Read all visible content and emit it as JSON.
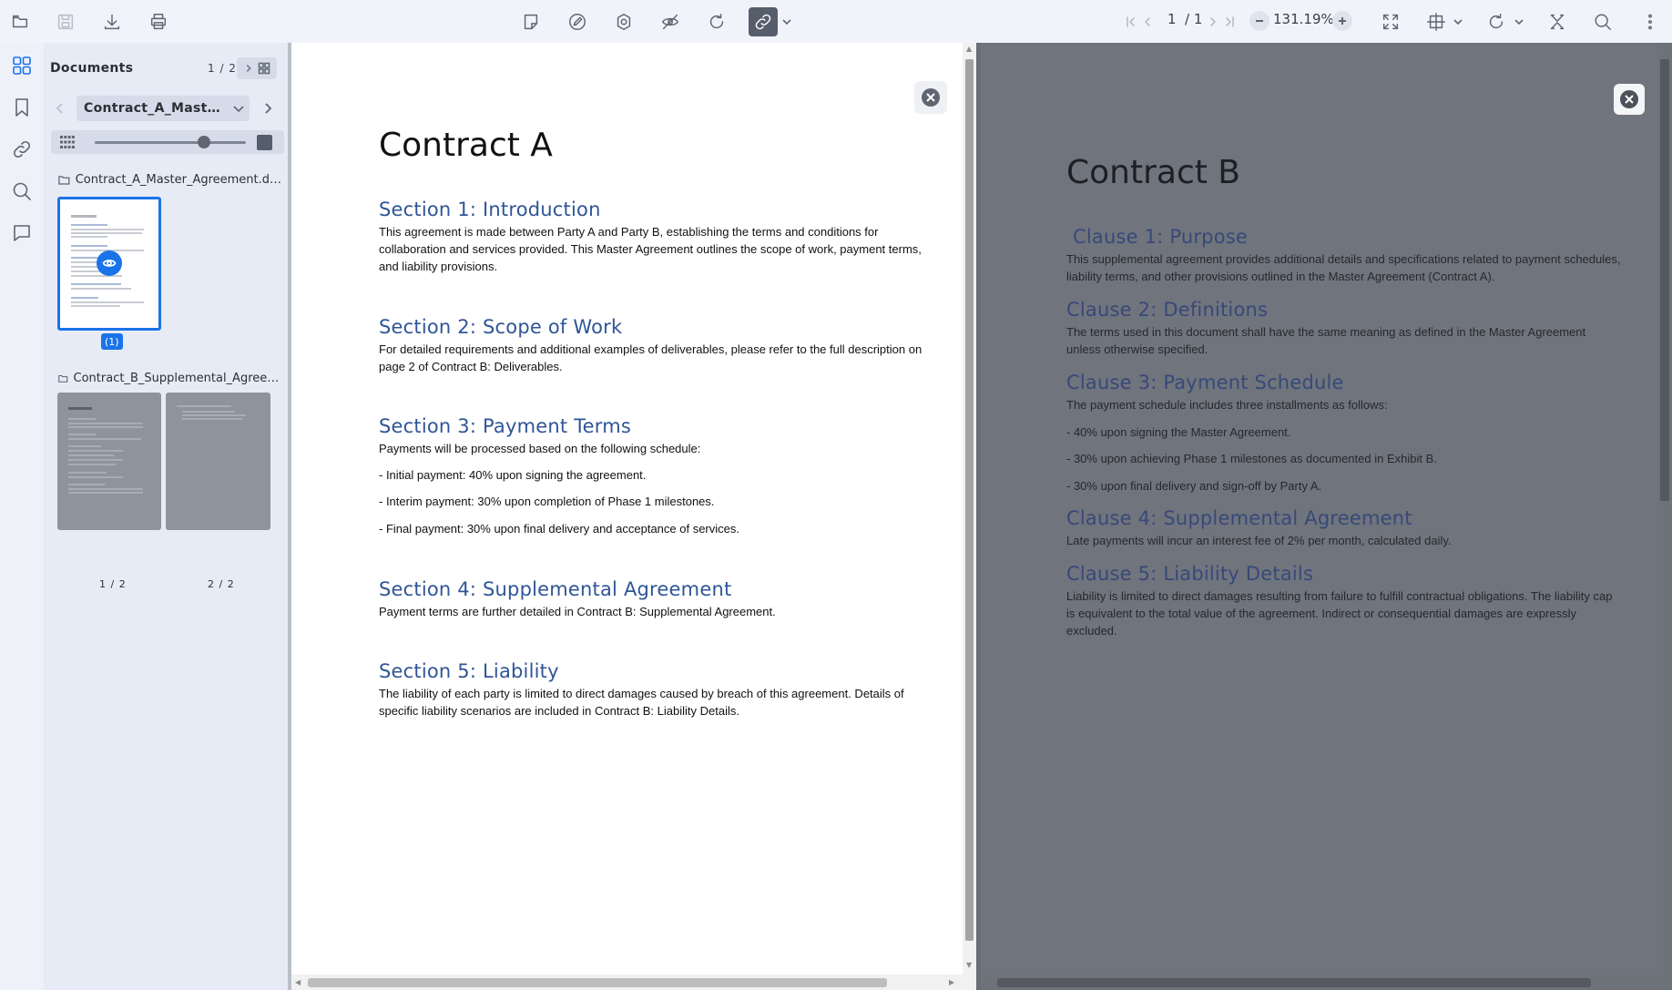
{
  "toolbar": {
    "page_current": "1",
    "page_total": "/ 1",
    "zoom": "131.19%"
  },
  "panel": {
    "title": "Documents",
    "count": "1 / 2",
    "selected_document": "Contract_A_Master_Agreement.docx",
    "size_slider_value": 0.72,
    "files": [
      {
        "name": "Contract_A_Master_Agreement.docx",
        "pages": [
          {
            "label": "(1)",
            "selected": true
          }
        ]
      },
      {
        "name": "Contract_B_Supplemental_Agreement.docx",
        "pages": [
          {
            "label": "1 / 2"
          },
          {
            "label": "2 / 2"
          }
        ]
      }
    ]
  },
  "docA": {
    "title": "Contract A",
    "sections": [
      {
        "heading": "Section 1: Introduction",
        "paragraphs": [
          "This agreement is made between Party A and Party B, establishing the terms and conditions for collaboration and services provided. This Master Agreement outlines the scope of work, payment terms, and liability provisions."
        ]
      },
      {
        "heading": "Section 2: Scope of Work",
        "paragraphs": [
          "For detailed requirements and additional examples of deliverables, please refer to the full description on page 2 of Contract B: Deliverables."
        ]
      },
      {
        "heading": "Section 3: Payment Terms",
        "paragraphs": [
          "Payments will be processed based on the following schedule:",
          "- Initial payment: 40% upon signing the agreement.",
          "- Interim payment: 30% upon completion of Phase 1 milestones.",
          "- Final payment: 30% upon final delivery and acceptance of services."
        ]
      },
      {
        "heading": "Section 4: Supplemental Agreement",
        "paragraphs": [
          "Payment terms are further detailed in Contract B: Supplemental Agreement."
        ]
      },
      {
        "heading": "Section 5: Liability",
        "paragraphs": [
          "The liability of each party is limited to direct damages caused by breach of this agreement. Details of specific liability scenarios are included in Contract B: Liability Details."
        ]
      }
    ]
  },
  "docB": {
    "title": "Contract B",
    "sections": [
      {
        "heading": "Clause 1: Purpose",
        "paragraphs": [
          "This supplemental agreement provides additional details and specifications related to payment schedules, liability terms, and other provisions outlined in the Master Agreement (Contract A)."
        ]
      },
      {
        "heading": "Clause 2: Definitions",
        "paragraphs": [
          "The terms used in this document shall have the same meaning as defined in the Master Agreement unless otherwise specified."
        ]
      },
      {
        "heading": "Clause 3: Payment Schedule",
        "paragraphs": [
          "The payment schedule includes three installments as follows:",
          "- 40% upon signing the Master Agreement.",
          "- 30% upon achieving Phase 1 milestones as documented in Exhibit B.",
          "- 30% upon final delivery and sign-off by Party A."
        ]
      },
      {
        "heading": "Clause 4: Supplemental Agreement",
        "paragraphs": [
          "Late payments will incur an interest fee of 2% per month, calculated daily."
        ]
      },
      {
        "heading": "Clause 5: Liability Details",
        "paragraphs": [
          "Liability is limited to direct damages resulting from failure to fulfill contractual obligations. The liability cap is equivalent to the total value of the agreement. Indirect or consequential damages are expressly excluded."
        ]
      }
    ]
  },
  "colors": {
    "accent": "#1a73e8",
    "heading": "#2f5597",
    "dim_overlay": "#70747c"
  },
  "icons": [
    "folder-open-icon",
    "save-icon",
    "download-icon",
    "print-icon",
    "note-icon",
    "draw-icon",
    "settings-icon",
    "hide-icon",
    "rotate-icon",
    "link-icon",
    "first-page-icon",
    "prev-page-icon",
    "next-page-icon",
    "last-page-icon",
    "zoom-out-icon",
    "zoom-in-icon",
    "fullscreen-icon",
    "fit-icon",
    "rotate-view-icon",
    "compare-icon",
    "search-icon",
    "more-icon",
    "grid-icon",
    "bookmark-icon",
    "attachment-icon",
    "comment-icon",
    "close-icon",
    "eye-icon"
  ]
}
